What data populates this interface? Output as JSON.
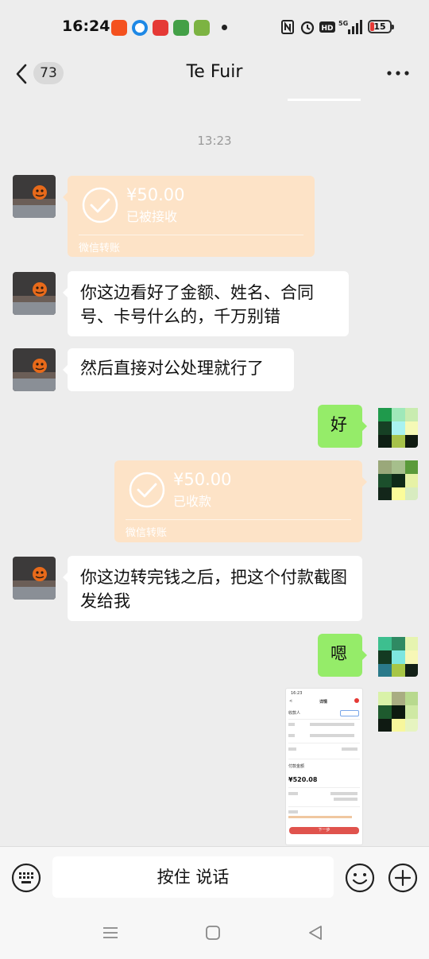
{
  "status_bar": {
    "time": "16:24",
    "battery": "15",
    "network": "5G",
    "app_icon_colors": [
      "#f4511e",
      "#1e88e5",
      "#e53935",
      "#43a047",
      "#7cb342"
    ]
  },
  "header": {
    "unread_count": "73",
    "title": "Te Fuir"
  },
  "chat": {
    "timestamp": "13:23",
    "messages": [
      {
        "side": "left",
        "type": "transfer",
        "amount": "¥50.00",
        "status": "已被接收",
        "label": "微信转账"
      },
      {
        "side": "left",
        "type": "text",
        "text": "你这边看好了金额、姓名、合同号、卡号什么的，千万别错"
      },
      {
        "side": "left",
        "type": "text",
        "text": "然后直接对公处理就行了"
      },
      {
        "side": "right",
        "type": "text",
        "text": "好"
      },
      {
        "side": "right",
        "type": "transfer",
        "amount": "¥50.00",
        "status": "已收款",
        "label": "微信转账"
      },
      {
        "side": "left",
        "type": "text",
        "text": "你这边转完钱之后，把这个付款截图发给我"
      },
      {
        "side": "right",
        "type": "text",
        "text": "嗯"
      },
      {
        "side": "right",
        "type": "image",
        "thumb": {
          "title": "详情",
          "payee_label": "收款人",
          "amount": "¥520.08",
          "amount_label": "付款金额",
          "button": "下一步"
        }
      }
    ]
  },
  "input_bar": {
    "hold_to_talk": "按住 说话"
  },
  "colors": {
    "background": "#ededed",
    "bubble_self": "#95ec69",
    "bubble_other": "#ffffff",
    "transfer": "#fde3c7"
  }
}
